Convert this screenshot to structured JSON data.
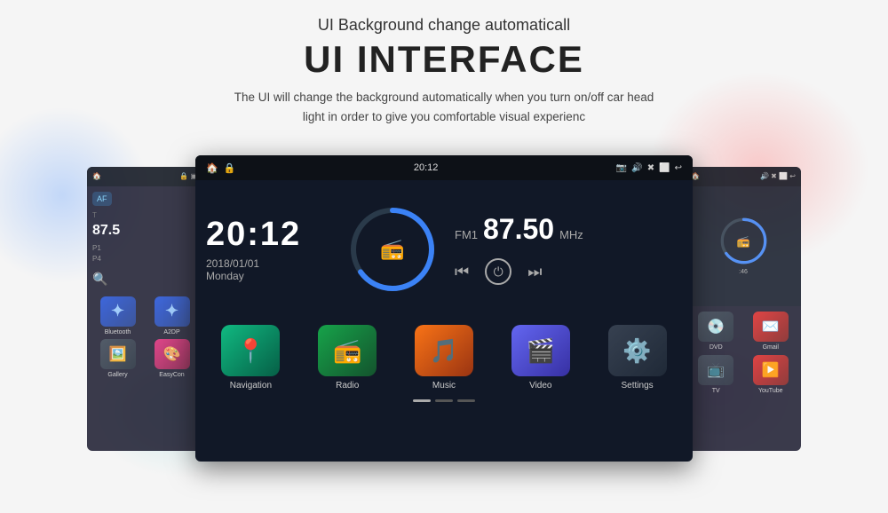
{
  "header": {
    "subtitle": "UI Background change automaticall",
    "title": "UI INTERFACE",
    "desc_line1": "The UI will change the background automatically when you turn on/off car head",
    "desc_line2": "light in order to give you comfortable visual experienc"
  },
  "main_screen": {
    "status_bar": {
      "left_icon": "🏠",
      "lock_icon": "🔒",
      "time": "20:12",
      "icons_right": [
        "📷",
        "🔊",
        "✖",
        "⬜",
        "↩"
      ]
    },
    "clock": {
      "time": "20:12",
      "date": "2018/01/01",
      "day": "Monday"
    },
    "fm": {
      "label": "FM1",
      "frequency": "87.50",
      "unit": "MHz"
    },
    "apps": [
      {
        "name": "Navigation",
        "color": "ic-nav",
        "icon": "📍"
      },
      {
        "name": "Radio",
        "color": "ic-radio",
        "icon": "📻"
      },
      {
        "name": "Music",
        "color": "ic-music",
        "icon": "🎵"
      },
      {
        "name": "Video",
        "color": "ic-video",
        "icon": "🎬"
      },
      {
        "name": "Settings",
        "color": "ic-settings",
        "icon": "⚙️"
      },
      {
        "name": "Bluetooth",
        "color": "ic-bluetooth",
        "icon": "₿"
      },
      {
        "name": "A2DP",
        "color": "ic-a2dp",
        "icon": "₿"
      },
      {
        "name": "Gallery",
        "color": "ic-gallery",
        "icon": "🖼️"
      },
      {
        "name": "EasyCon",
        "color": "ic-easycon",
        "icon": "🎨"
      }
    ]
  },
  "left_screen": {
    "fm_label": "87.5",
    "labels": [
      "P1",
      "P4"
    ],
    "icon_label": "AF"
  },
  "right_screen": {
    "apps": [
      {
        "name": "DVD",
        "color": "ic-dvd",
        "icon": "💿"
      },
      {
        "name": "Gmail",
        "color": "ic-gmail",
        "icon": "✉️"
      },
      {
        "name": "TV",
        "color": "ic-tv",
        "icon": "📺"
      },
      {
        "name": "YouTube",
        "color": "ic-youtube",
        "icon": "▶️"
      }
    ]
  }
}
